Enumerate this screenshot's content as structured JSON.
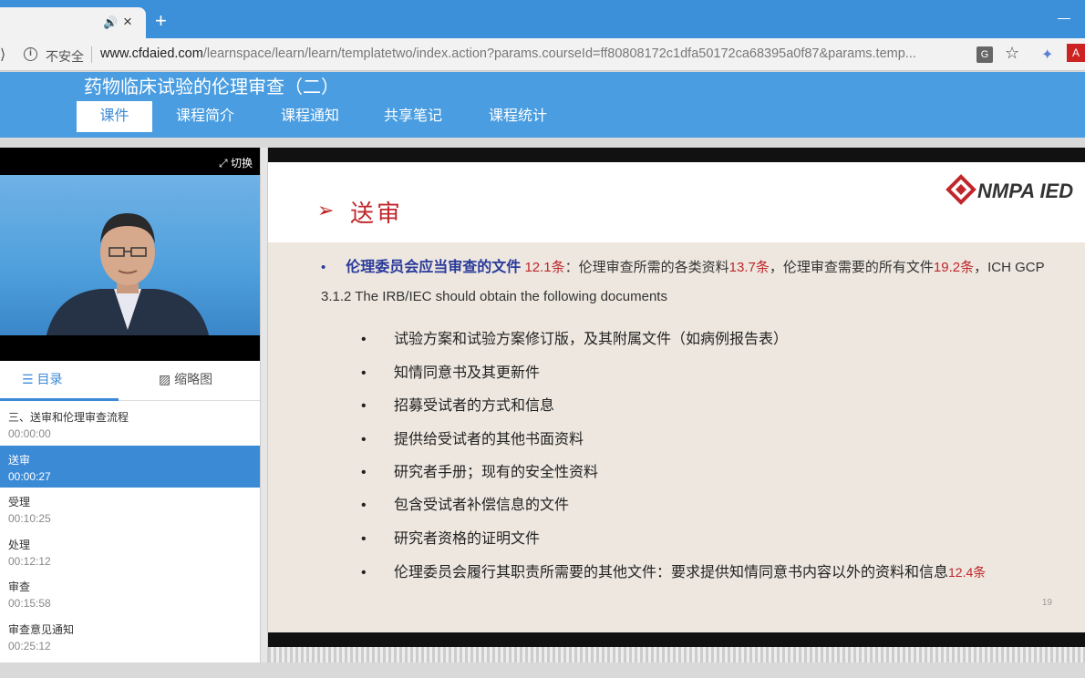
{
  "browser": {
    "url_insecure": "不安全",
    "url_host": "www.cfdaied.com",
    "url_path": "/learnspace/learn/learn/templatetwo/index.action?params.courseId=ff80808172c1dfa50172ca68395a0f87&params.temp..."
  },
  "site": {
    "course_title": "药物临床试验的伦理审查（二）",
    "nav_tabs": [
      "课件",
      "课程简介",
      "课程通知",
      "共享笔记",
      "课程统计"
    ]
  },
  "left": {
    "switch_label": "切换",
    "tab_toc": "目录",
    "tab_thumbs": "缩略图",
    "toc": [
      {
        "title": "三、送审和伦理审查流程",
        "time": "00:00:00"
      },
      {
        "title": "送审",
        "time": "00:00:27"
      },
      {
        "title": "受理",
        "time": "00:10:25"
      },
      {
        "title": "处理",
        "time": "00:12:12"
      },
      {
        "title": "审查",
        "time": "00:15:58"
      },
      {
        "title": "审查意见通知",
        "time": "00:25:12"
      }
    ]
  },
  "slide": {
    "title": "送审",
    "logo": "NMPA IED",
    "lead": "伦理委员会应当审查的文件",
    "ref1": "12.1条",
    "mid1": "：伦理审查所需的各类资料",
    "ref2": "13.7条",
    "mid2": "，伦理审查需要的所有文件",
    "ref3": "19.2条",
    "tail": "，ICH GCP 3.1.2 The IRB/IEC should obtain the following documents",
    "items": [
      "试验方案和试验方案修订版，及其附属文件（如病例报告表）",
      "知情同意书及其更新件",
      "招募受试者的方式和信息",
      "提供给受试者的其他书面资料",
      "研究者手册；现有的安全性资料",
      "包含受试者补偿信息的文件",
      "研究者资格的证明文件",
      "伦理委员会履行其职责所需要的其他文件：要求提供知情同意书内容以外的资料和信息"
    ],
    "last_ref": "12.4条",
    "page": "19"
  }
}
